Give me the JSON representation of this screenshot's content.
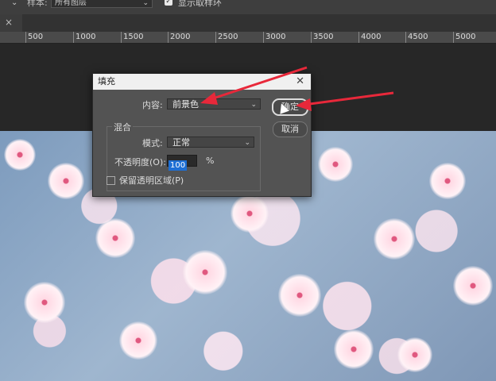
{
  "options_bar": {
    "sample_label": "样本:",
    "sample_value": "所有图层",
    "show_sampling_ring_label": "显示取样环"
  },
  "ruler": {
    "ticks": [
      "500",
      "1000",
      "1500",
      "2000",
      "2500",
      "3000",
      "3500",
      "4000",
      "4500",
      "5000"
    ]
  },
  "dialog": {
    "title": "填充",
    "content_label": "内容:",
    "content_value": "前景色",
    "blend_group_title": "混合",
    "mode_label": "模式:",
    "mode_value": "正常",
    "opacity_label": "不透明度(O):",
    "opacity_value": "100",
    "opacity_unit": "%",
    "preserve_transparency_label": "保留透明区域(P)",
    "ok_label": "确定",
    "cancel_label": "取消"
  },
  "colors": {
    "annotation_arrow": "#e8283a",
    "dialog_bg": "#535353",
    "selection_blue": "#1e6fd4"
  }
}
